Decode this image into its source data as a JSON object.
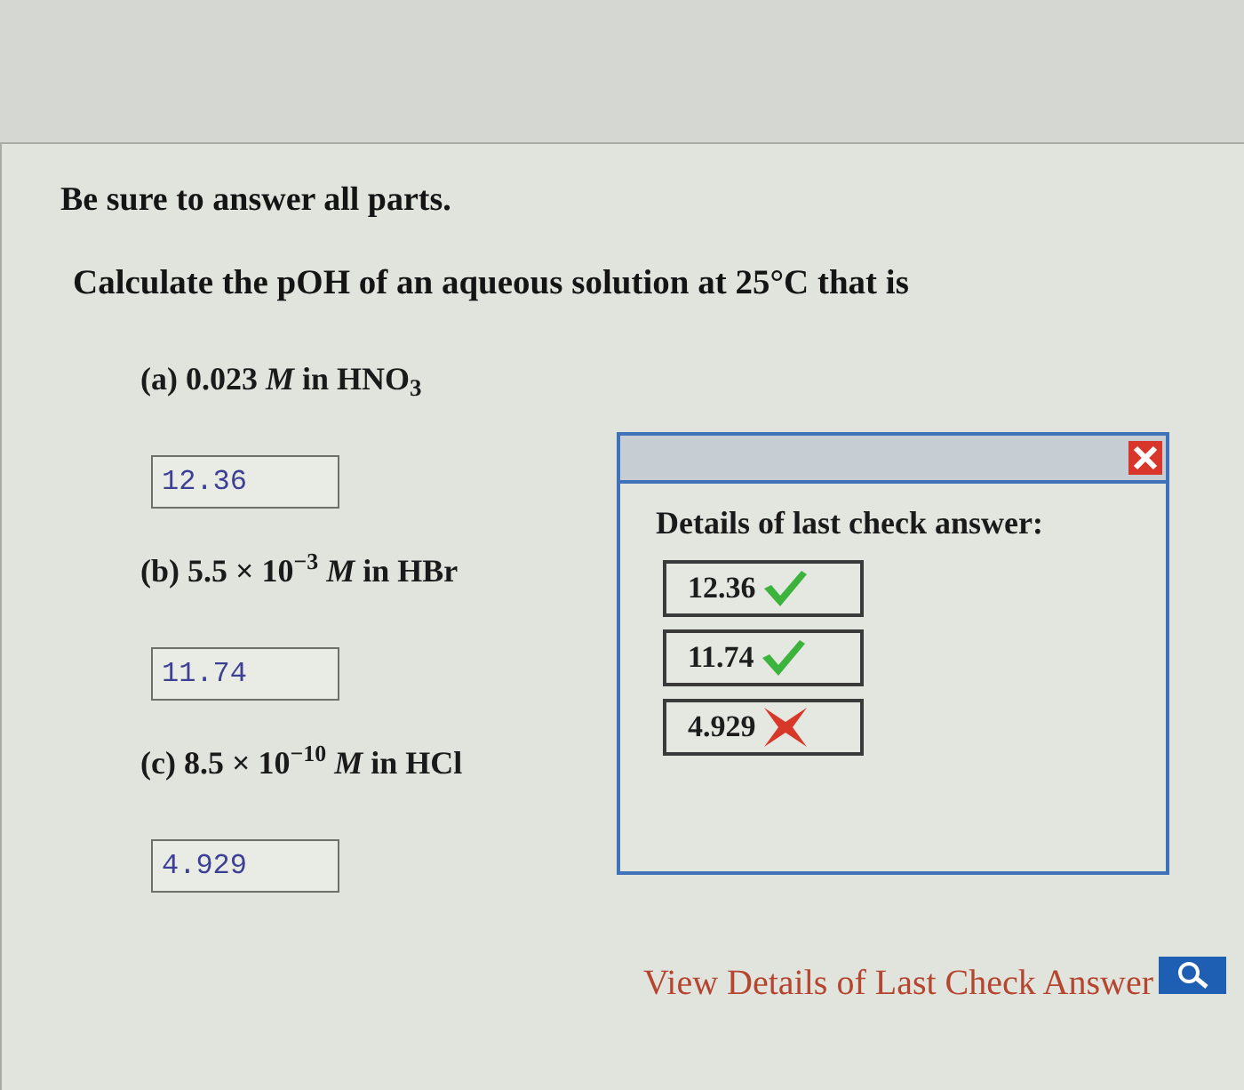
{
  "instruction": "Be sure to answer all parts.",
  "question": "Calculate the pOH of an aqueous solution at 25°C that is",
  "parts": [
    {
      "label": "(a) 0.023 *M* in HNO$_{3}$",
      "answer": "12.36"
    },
    {
      "label": "(b) 5.5 × 10$^{−3}$ *M* in HBr",
      "answer": "11.74"
    },
    {
      "label": "(c) 8.5 × 10$^{−10}$ *M* in HCl",
      "answer": "4.929"
    }
  ],
  "check_dialog": {
    "heading": "Details of last check answer:",
    "results": [
      {
        "value": "12.36",
        "correct": true
      },
      {
        "value": "11.74",
        "correct": true
      },
      {
        "value": "4.929",
        "correct": false
      }
    ]
  },
  "link": {
    "text": "View Details of Last Check Answer"
  }
}
